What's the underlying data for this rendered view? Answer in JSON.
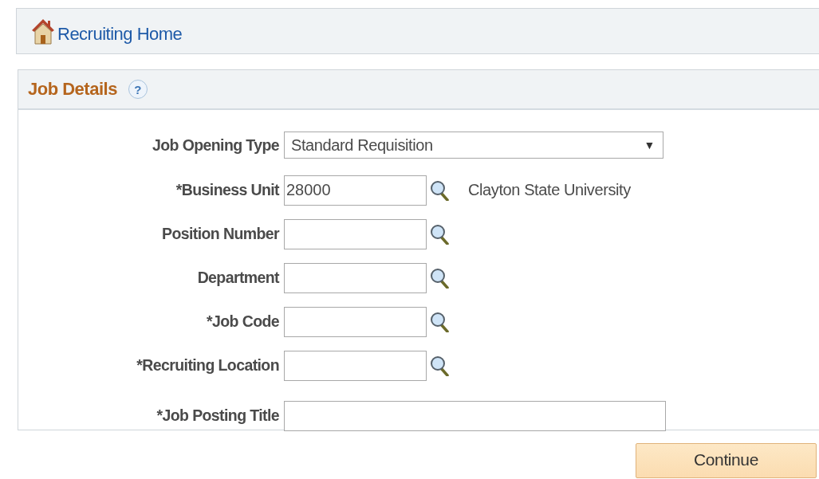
{
  "home_link": {
    "label": "Recruiting Home"
  },
  "panel": {
    "title": "Job Details",
    "help": "?"
  },
  "fields": [
    {
      "kind": "dropdown",
      "label": "Job Opening Type",
      "value": "Standard Requisition",
      "caret": "▼"
    },
    {
      "kind": "lookup",
      "label": "*Business Unit",
      "value": "28000",
      "description": "Clayton State University"
    },
    {
      "kind": "lookup",
      "label": "Position Number"
    },
    {
      "kind": "lookup",
      "label": "Department"
    },
    {
      "kind": "lookup",
      "label": "*Job Code"
    },
    {
      "kind": "lookup",
      "label": "*Recruiting Location"
    },
    {
      "kind": "text",
      "label": "*Job Posting Title"
    }
  ],
  "buttons": [
    {
      "label": "Continue"
    }
  ]
}
